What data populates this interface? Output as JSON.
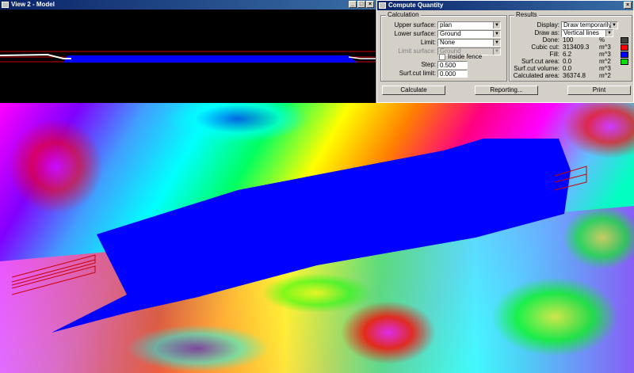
{
  "view_window": {
    "title": "View 2 - Model"
  },
  "dialog": {
    "title": "Compute Quantity",
    "calculation": {
      "group_label": "Calculation",
      "upper_surface": {
        "label": "Upper surface:",
        "value": "plan"
      },
      "lower_surface": {
        "label": "Lower surface:",
        "value": "Ground"
      },
      "limit": {
        "label": "Limit:",
        "value": "None"
      },
      "limit_surface": {
        "label": "Limit surface:",
        "value": "Ground"
      },
      "inside_fence": {
        "label": "Inside fence",
        "checked": false
      },
      "step": {
        "label": "Step:",
        "value": "0.500"
      },
      "surf_cut_limit": {
        "label": "Surf.cut limit:",
        "value": "0.000"
      }
    },
    "results": {
      "group_label": "Results",
      "display": {
        "label": "Display:",
        "value": "Draw temporarily"
      },
      "draw_as": {
        "label": "Draw as:",
        "value": "Vertical lines"
      },
      "rows": [
        {
          "label": "Done:",
          "value": "100",
          "unit": "%",
          "color": "#404040"
        },
        {
          "label": "Cubic cut:",
          "value": "313409.3",
          "unit": "m^3",
          "color": "#ff0000"
        },
        {
          "label": "Fill:",
          "value": "6.2",
          "unit": "m^3",
          "color": "#0000ff"
        },
        {
          "label": "Surf.cut area:",
          "value": "0.0",
          "unit": "m^2",
          "color": "#00e000"
        },
        {
          "label": "Surf.cut volume:",
          "value": "0.0",
          "unit": "m^3",
          "color": ""
        },
        {
          "label": "Calculated area:",
          "value": "36374.8",
          "unit": "m^2",
          "color": ""
        }
      ]
    },
    "buttons": {
      "calculate": "Calculate",
      "reporting": "Reporting...",
      "print": "Print"
    }
  }
}
